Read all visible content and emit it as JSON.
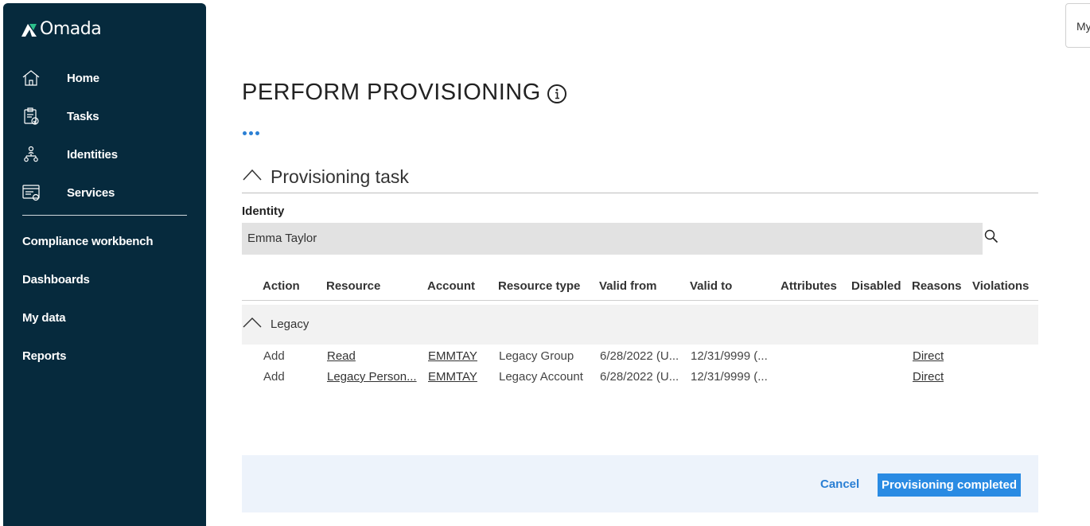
{
  "app": {
    "logo_text": "Omada"
  },
  "sidebar": {
    "items": [
      {
        "label": "Home",
        "icon": "home-icon"
      },
      {
        "label": "Tasks",
        "icon": "tasks-icon"
      },
      {
        "label": "Identities",
        "icon": "identities-icon"
      },
      {
        "label": "Services",
        "icon": "services-icon"
      }
    ],
    "links": [
      {
        "label": "Compliance workbench"
      },
      {
        "label": "Dashboards"
      },
      {
        "label": "My data"
      },
      {
        "label": "Reports"
      }
    ]
  },
  "topbar": {
    "right_button_label": "My"
  },
  "page": {
    "title": "PERFORM PROVISIONING",
    "section_title": "Provisioning task",
    "identity_label": "Identity",
    "identity_value": "Emma Taylor"
  },
  "table": {
    "columns": [
      "Action",
      "Resource",
      "Account",
      "Resource type",
      "Valid from",
      "Valid to",
      "Attributes",
      "Disabled",
      "Reasons",
      "Violations"
    ],
    "group_label": "Legacy",
    "rows": [
      {
        "action": "Add",
        "resource": "Read",
        "account": "EMMTAY",
        "resource_type": "Legacy Group",
        "valid_from": "6/28/2022 (U...",
        "valid_to": "12/31/9999 (...",
        "attributes": "",
        "disabled": "",
        "reasons": "Direct",
        "violations": ""
      },
      {
        "action": "Add",
        "resource": "Legacy Person...",
        "account": "EMMTAY",
        "resource_type": "Legacy Account",
        "valid_from": "6/28/2022 (U...",
        "valid_to": "12/31/9999 (...",
        "attributes": "",
        "disabled": "",
        "reasons": "Direct",
        "violations": ""
      }
    ]
  },
  "footer": {
    "cancel_label": "Cancel",
    "complete_label": "Provisioning completed"
  },
  "colors": {
    "sidebar_bg": "#062a3d",
    "accent": "#2a8be3",
    "logo_green": "#2bbf8a"
  }
}
